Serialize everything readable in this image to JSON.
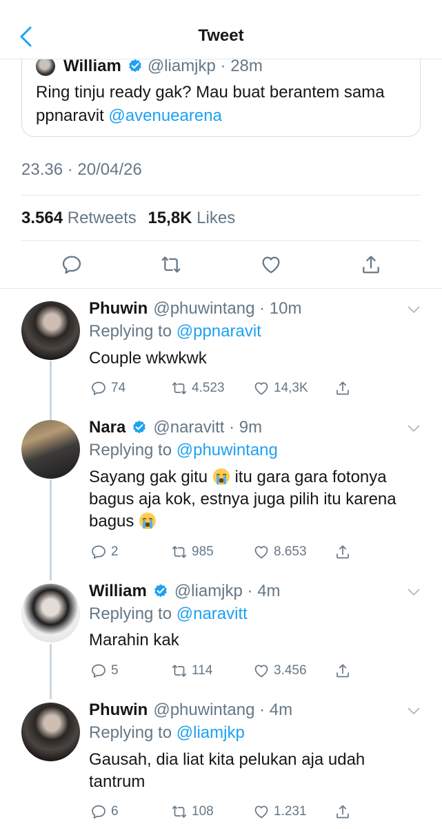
{
  "header": {
    "title": "Tweet",
    "back_icon": "chevron-left-icon"
  },
  "quote": {
    "name": "William",
    "handle_time": "@liamjkp · 28m",
    "text": "Ring tinju ready gak? Mau buat berantem sama ppnaravit ",
    "mention": "@avenuearena"
  },
  "timestamp": "23.36 · 20/04/26",
  "stats": {
    "retweets_count": "3.564",
    "retweets_label": "Retweets",
    "likes_count": "15,8K",
    "likes_label": "Likes"
  },
  "colors": {
    "accent": "#1da1f2",
    "muted": "#657786",
    "text": "#14171a",
    "divider": "#e1e8ed"
  },
  "replies": [
    {
      "name": "Phuwin",
      "verified": false,
      "handle_time": "@phuwintang · 10m",
      "replying_prefix": "Replying to ",
      "replying_to": "@ppnaravit",
      "text": "Couple wkwkwk",
      "replies": "74",
      "retweets": "4.523",
      "likes": "14,3K"
    },
    {
      "name": "Nara",
      "verified": true,
      "handle_time": "@naravitt · 9m",
      "replying_prefix": "Replying to ",
      "replying_to": "@phuwintang",
      "text_1": "Sayang gak gitu ",
      "text_2": " itu gara gara fotonya bagus aja kok, estnya juga pilih itu karena bagus ",
      "replies": "2",
      "retweets": "985",
      "likes": "8.653"
    },
    {
      "name": "William",
      "verified": true,
      "handle_time": "@liamjkp · 4m",
      "replying_prefix": "Replying to ",
      "replying_to": "@naravitt",
      "text": "Marahin kak",
      "replies": "5",
      "retweets": "114",
      "likes": "3.456"
    },
    {
      "name": "Phuwin",
      "verified": false,
      "handle_time": "@phuwintang · 4m",
      "replying_prefix": "Replying to ",
      "replying_to": "@liamjkp",
      "text": "Gausah, dia liat kita pelukan aja udah tantrum",
      "replies": "6",
      "retweets": "108",
      "likes": "1.231"
    }
  ]
}
